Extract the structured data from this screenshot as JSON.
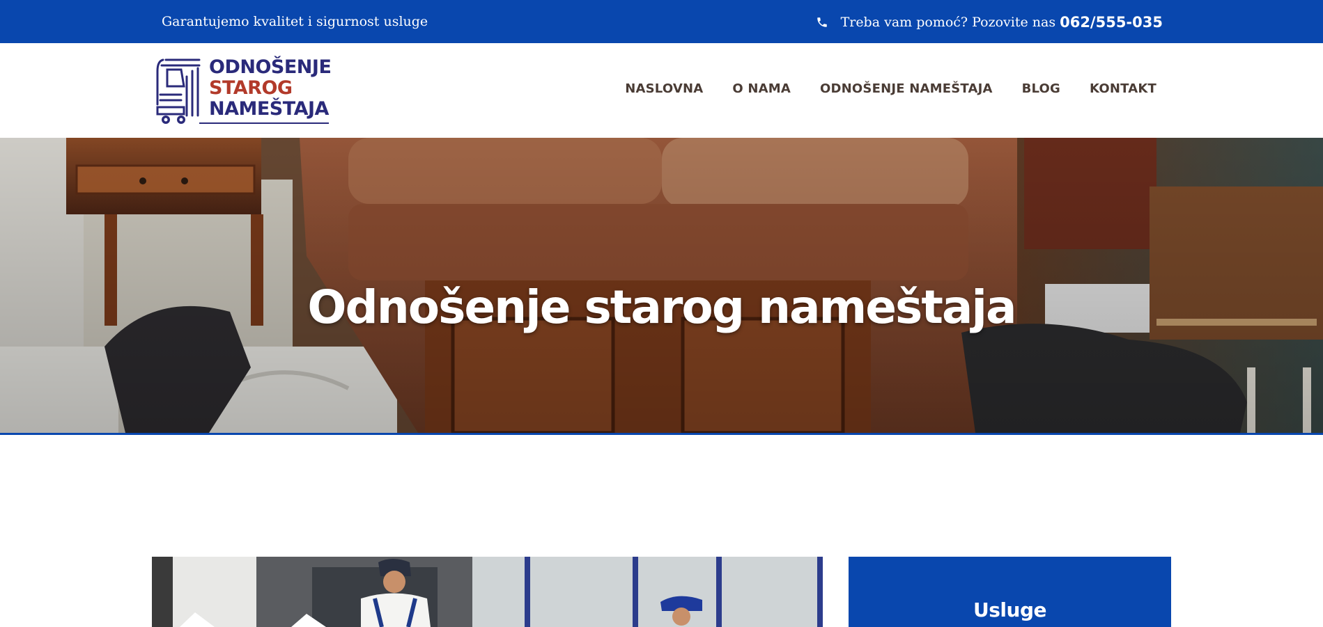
{
  "colors": {
    "brand": "#0947ae",
    "nav_text": "#4a3c35",
    "logo_primary": "#2a2a7a",
    "logo_accent": "#b23a2a"
  },
  "topbar": {
    "tagline": "Garantujemo kvalitet i sigurnost usluge",
    "phone_icon": "phone-icon",
    "help_text": "Treba vam pomoć? Pozovite nas",
    "phone_number": "062/555-035"
  },
  "logo": {
    "line1": "ODNOŠENJE",
    "line2": "STAROG",
    "line3": "NAMEŠTAJA",
    "icon": "truck-icon"
  },
  "nav": {
    "items": [
      {
        "label": "NASLOVNA"
      },
      {
        "label": "O NAMA"
      },
      {
        "label": "ODNOŠENJE NAMEŠTAJA"
      },
      {
        "label": "BLOG"
      },
      {
        "label": "KONTAKT"
      }
    ]
  },
  "hero": {
    "title": "Odnošenje starog nameštaja"
  },
  "sidebar": {
    "services_title": "Usluge"
  }
}
